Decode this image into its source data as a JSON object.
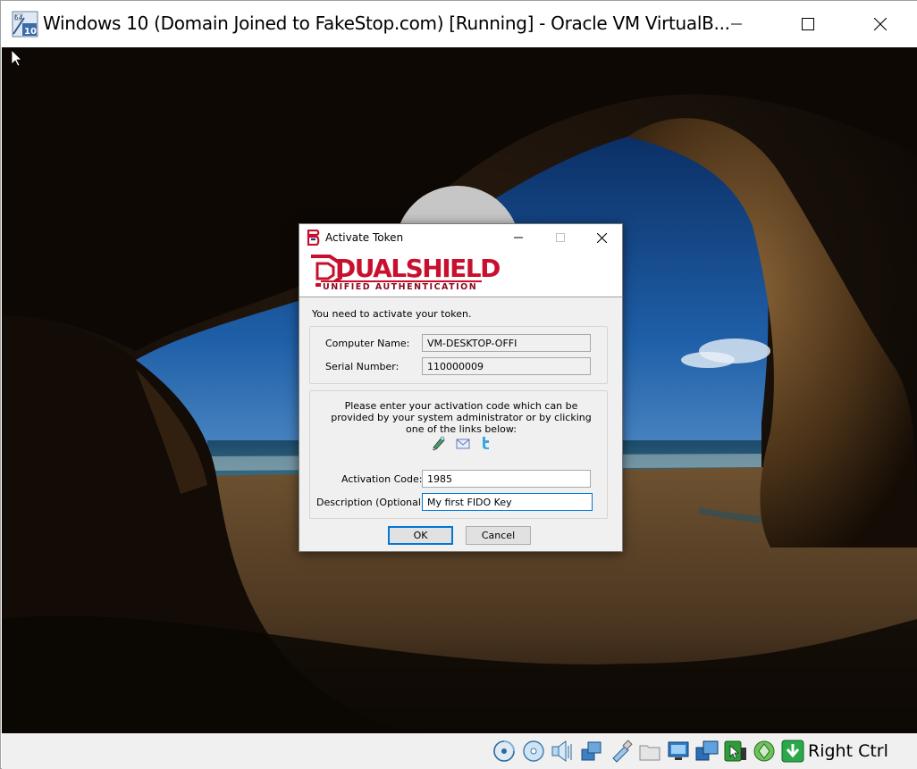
{
  "window": {
    "title": "Windows 10 (Domain Joined to FakeStop.com) [Running] - Oracle VM VirtualB...",
    "icon": "virtualbox-vm-icon",
    "badge_top": "64",
    "badge_bottom": "10"
  },
  "dialog": {
    "title": "Activate Token",
    "logo": {
      "main": "DUALSHIELD",
      "sub": "UNIFIED AUTHENTICATION",
      "brand_color": "#c8102e"
    },
    "intro": "You need to activate your token.",
    "computer_name_label": "Computer Name:",
    "computer_name_value": "VM-DESKTOP-OFFI",
    "serial_number_label": "Serial Number:",
    "serial_number_value": "110000009",
    "instructions": "Please enter your activation code which can be provided by your system administrator or by clicking one of the links below:",
    "link_icons": [
      "mobile-app-icon",
      "email-icon",
      "twitter-icon"
    ],
    "activation_code_label": "Activation Code:",
    "activation_code_value": "1985",
    "description_label": "Description (Optional):",
    "description_value": "My first FIDO Key",
    "ok_label": "OK",
    "cancel_label": "Cancel",
    "focus_color": "#0078d7"
  },
  "statusbar": {
    "icons": [
      "hard-disk-icon",
      "optical-drive-icon",
      "audio-icon",
      "network-icon",
      "usb-icon",
      "shared-folders-icon",
      "display-icon",
      "video-capture-icon",
      "mouse-integration-icon",
      "recording-icon",
      "host-key-arrow-icon"
    ],
    "host_key": "Right Ctrl"
  }
}
